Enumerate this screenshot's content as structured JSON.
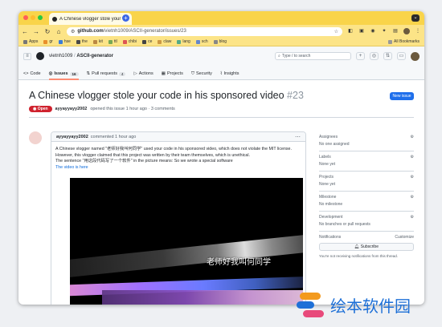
{
  "browser": {
    "tab_title": "A Chinese vlogger stole your",
    "url_domain": "github.com",
    "url_path": "/vietnh1009/ASCII-generator/issues/23",
    "bookmarks": [
      "Apps",
      "gr",
      "hse",
      "the",
      "kit",
      "ttl",
      "chibi",
      "ce",
      "claw",
      "lang",
      "sch",
      "blog",
      "All Bookmarks"
    ],
    "colors": {
      "tabbar": "#f9d44a",
      "toolbar": "#fce487",
      "dot_red": "#ff5f57",
      "dot_yellow": "#febc2e",
      "dot_green": "#28c840"
    }
  },
  "github": {
    "owner": "vietnh1009",
    "separator": "/",
    "repo": "ASCII-generator",
    "search_placeholder": "Type / to search",
    "tabs": [
      {
        "label": "Code",
        "count": ""
      },
      {
        "label": "Issues",
        "count": "16"
      },
      {
        "label": "Pull requests",
        "count": "4"
      },
      {
        "label": "Actions",
        "count": ""
      },
      {
        "label": "Projects",
        "count": ""
      },
      {
        "label": "Security",
        "count": ""
      },
      {
        "label": "Insights",
        "count": ""
      }
    ]
  },
  "issue": {
    "title": "A Chinese vlogger stole your code in his sponsored video",
    "number": "#23",
    "new_issue_label": "New issue",
    "state": "Open",
    "author": "ayyayyayy2002",
    "opened_text": "opened this issue 1 hour ago · 3 comments",
    "comment": {
      "author": "ayyayyayy2002",
      "time": "commented 1 hour ago",
      "lines": [
        "A Chinese vlogger named \"老师好我叫何同学\" used your code in his sponsored video, which does not violate the MIT license.",
        "However, this vlogger claimed that this project was written by their team themselves, which is unethical.",
        "The sentence \"用这段代码写了一个软件\" in the picture means: So we wrote a special software"
      ],
      "link_text": "The video is here",
      "video_subtitle": "老师好我叫何同学"
    }
  },
  "sidebar": [
    {
      "heading": "Assignees",
      "value": "No one assigned"
    },
    {
      "heading": "Labels",
      "value": "None yet"
    },
    {
      "heading": "Projects",
      "value": "None yet"
    },
    {
      "heading": "Milestone",
      "value": "No milestone"
    },
    {
      "heading": "Development",
      "value": "No branches or pull requests"
    }
  ],
  "notifications": {
    "heading": "Notifications",
    "customize": "Customize",
    "subscribe_label": "Subscribe",
    "note": "You're not receiving notifications from this thread."
  },
  "watermark": {
    "text": "绘本软件园"
  }
}
